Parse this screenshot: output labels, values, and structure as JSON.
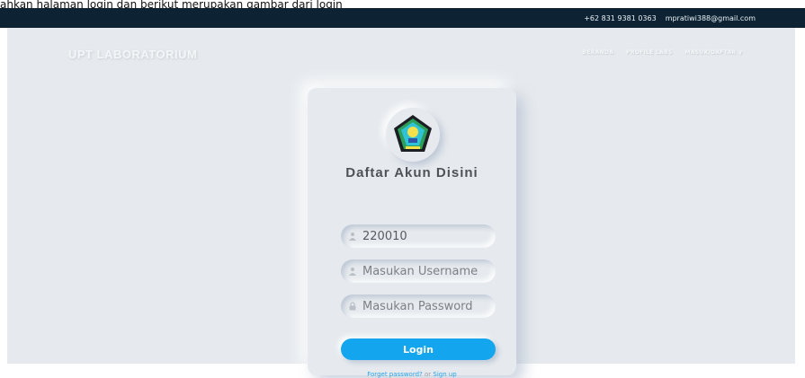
{
  "caption": "ahkan halaman login dan berikut merupakan gambar dari login",
  "topbar": {
    "phone": "+62 831 9381 0363",
    "email": "mpratiwi388@gmail.com"
  },
  "header": {
    "brand": "UPT LABORATORIUM",
    "nav": [
      "BERANDA",
      "PROFILE LABS",
      "MASUK/DAFTAR ∨"
    ]
  },
  "login": {
    "heading": "Daftar Akun Disini",
    "id_value": "220010",
    "username_placeholder": "Masukan Username",
    "password_placeholder": "Masukan Password",
    "button_label": "Login",
    "forgot_label": "Forget password?",
    "or_label": "or",
    "signup_label": "Sign up"
  },
  "colors": {
    "topbar": "#0d2333",
    "background": "#e6eaee",
    "accent": "#13a6ef"
  },
  "icons": [
    "user-icon",
    "user-icon",
    "lock-icon",
    "institution-logo"
  ]
}
